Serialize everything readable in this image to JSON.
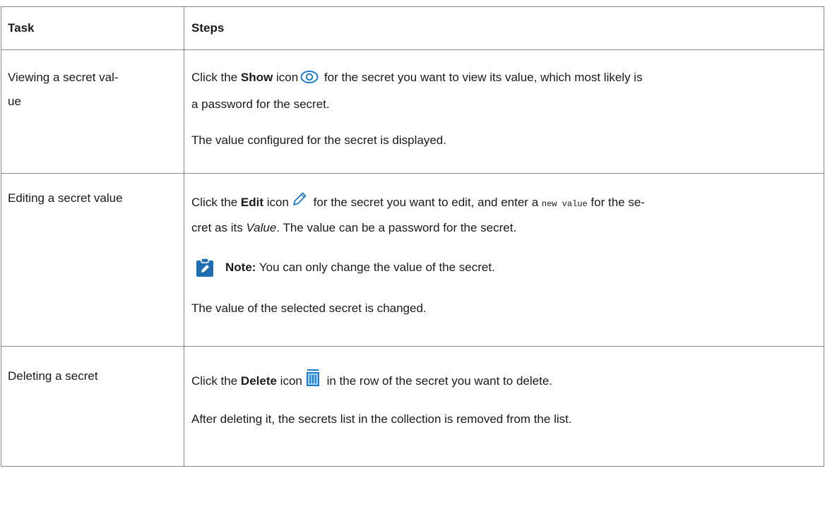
{
  "table": {
    "headers": {
      "task": "Task",
      "steps": "Steps"
    },
    "rows": [
      {
        "task": "Viewing a secret val-ue",
        "task_line1": "Viewing a secret val-",
        "task_line2": "ue",
        "step1_pre": "Click the ",
        "step1_bold": "Show",
        "step1_mid": " icon",
        "step1_post_line1": " for the secret you want to view its value, which most likely is",
        "step1_post_line2": "a password for the secret.",
        "step1_icon": "eye-icon",
        "result": "The value configured for the secret is displayed."
      },
      {
        "task": "Editing a secret value",
        "step1_pre": "Click the ",
        "step1_bold": "Edit",
        "step1_mid": " icon",
        "step1_icon": "pencil-icon",
        "step1_post_a": " for the secret you want to edit, and enter a ",
        "step1_code": "new value",
        "step1_post_b": " for the se-",
        "step1_line2_pre": "cret as its ",
        "step1_line2_italic": "Value",
        "step1_line2_post": ". The value can be a password for the secret.",
        "note_label": "Note:",
        "note_text": " You can only change the value of the secret.",
        "note_icon": "note-icon",
        "result": "The value of the selected secret is changed."
      },
      {
        "task": "Deleting a secret",
        "step1_pre": "Click the ",
        "step1_bold": "Delete",
        "step1_mid": " icon",
        "step1_icon": "trash-icon",
        "step1_post": " in the row of the secret you want to delete.",
        "result": "After deleting it, the secrets list in the collection is removed from the list."
      }
    ]
  },
  "colors": {
    "icon_blue": "#1f7dc7",
    "note_blue": "#1f6fb0",
    "border": "#8a8a8a"
  }
}
